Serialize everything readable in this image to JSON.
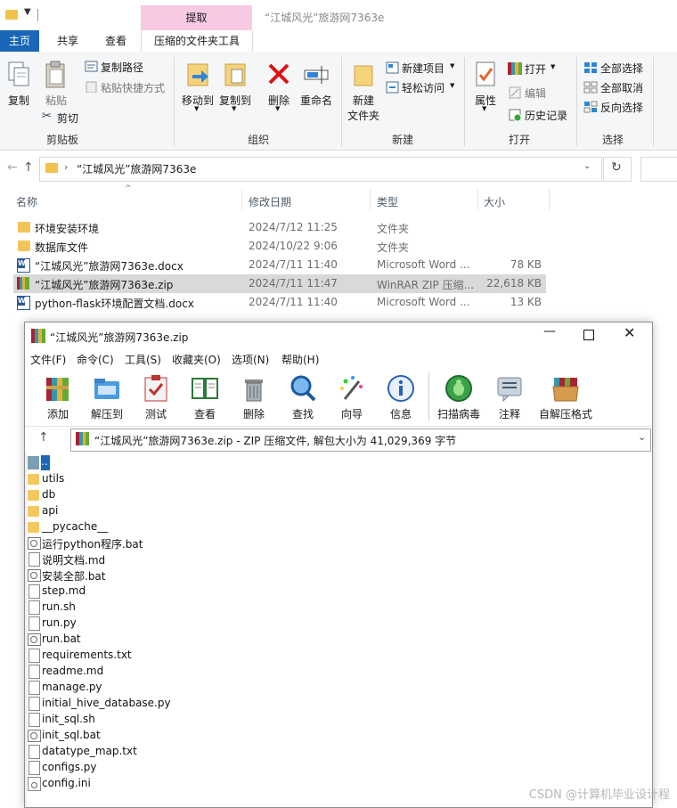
{
  "explorer": {
    "ctx_tab": "提取",
    "title": "“江城风光”旅游网7363e",
    "tabs": [
      "主页",
      "共享",
      "查看",
      "压缩的文件夹工具"
    ],
    "ribbon": {
      "clipboard": {
        "copy": "复制",
        "paste": "粘贴",
        "copy_path": "复制路径",
        "paste_shortcut": "粘贴快捷方式",
        "cut": "剪切",
        "label": "剪贴板"
      },
      "organize": {
        "move_to": "移动到",
        "copy_to": "复制到",
        "delete": "删除",
        "rename": "重命名",
        "label": "组织"
      },
      "new": {
        "new_folder_l1": "新建",
        "new_folder_l2": "文件夹",
        "new_item": "新建项目",
        "easy_access": "轻松访问",
        "label": "新建"
      },
      "open": {
        "properties": "属性",
        "open": "打开",
        "edit": "编辑",
        "history": "历史记录",
        "label": "打开"
      },
      "select": {
        "select_all": "全部选择",
        "select_none": "全部取消",
        "invert": "反向选择",
        "label": "选择"
      }
    },
    "address": "“江城风光”旅游网7363e",
    "columns": {
      "name": "名称",
      "date": "修改日期",
      "type": "类型",
      "size": "大小"
    },
    "files": [
      {
        "icon": "folder-icon",
        "name": "环境安装环境",
        "date": "2024/7/12 11:25",
        "type": "文件夹",
        "size": ""
      },
      {
        "icon": "folder-icon",
        "name": "数据库文件",
        "date": "2024/10/22 9:06",
        "type": "文件夹",
        "size": ""
      },
      {
        "icon": "word-icon",
        "name": "“江城风光”旅游网7363e.docx",
        "date": "2024/7/11 11:40",
        "type": "Microsoft Word ...",
        "size": "78 KB"
      },
      {
        "icon": "rar-icon",
        "name": "“江城风光”旅游网7363e.zip",
        "date": "2024/7/11 11:47",
        "type": "WinRAR ZIP 压缩...",
        "size": "22,618 KB"
      },
      {
        "icon": "word-icon",
        "name": "python-flask环境配置文档.docx",
        "date": "2024/7/11 11:40",
        "type": "Microsoft Word ...",
        "size": "13 KB"
      }
    ]
  },
  "winrar": {
    "title": "“江城风光”旅游网7363e.zip",
    "menu": [
      "文件(F)",
      "命令(C)",
      "工具(S)",
      "收藏夹(O)",
      "选项(N)",
      "帮助(H)"
    ],
    "tools": [
      "添加",
      "解压到",
      "测试",
      "查看",
      "删除",
      "查找",
      "向导",
      "信息",
      "扫描病毒",
      "注释",
      "自解压格式"
    ],
    "path": "“江城风光”旅游网7363e.zip - ZIP 压缩文件, 解包大小为 41,029,369 字节",
    "up": "..",
    "entries": [
      {
        "icon": "folder-icon",
        "name": "utils"
      },
      {
        "icon": "folder-icon",
        "name": "db"
      },
      {
        "icon": "folder-icon",
        "name": "api"
      },
      {
        "icon": "folder-icon",
        "name": "__pycache__"
      },
      {
        "icon": "bat-icon",
        "name": "运行python程序.bat"
      },
      {
        "icon": "file-icon",
        "name": "说明文档.md"
      },
      {
        "icon": "bat-icon",
        "name": "安装全部.bat"
      },
      {
        "icon": "file-icon",
        "name": "step.md"
      },
      {
        "icon": "file-icon",
        "name": "run.sh"
      },
      {
        "icon": "file-icon",
        "name": "run.py"
      },
      {
        "icon": "bat-icon",
        "name": "run.bat"
      },
      {
        "icon": "file-icon",
        "name": "requirements.txt"
      },
      {
        "icon": "file-icon",
        "name": "readme.md"
      },
      {
        "icon": "file-icon",
        "name": "manage.py"
      },
      {
        "icon": "file-icon",
        "name": "initial_hive_database.py"
      },
      {
        "icon": "file-icon",
        "name": "init_sql.sh"
      },
      {
        "icon": "bat-icon",
        "name": "init_sql.bat"
      },
      {
        "icon": "file-icon",
        "name": "datatype_map.txt"
      },
      {
        "icon": "file-icon",
        "name": "configs.py"
      },
      {
        "icon": "ini-icon",
        "name": "config.ini"
      }
    ]
  },
  "watermark": "CSDN @计算机毕业设计程"
}
